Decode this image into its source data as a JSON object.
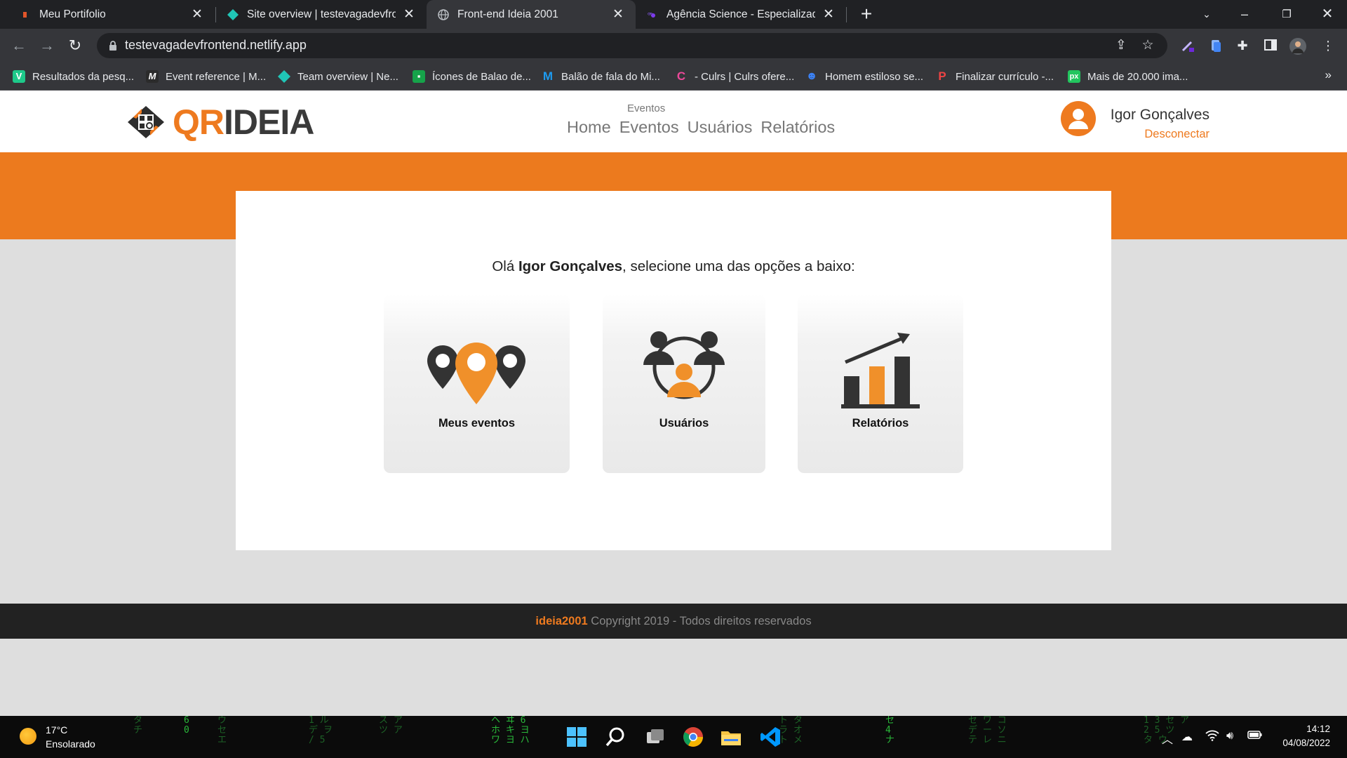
{
  "browser": {
    "tabs": [
      {
        "title": "Meu Portifolio",
        "active": false
      },
      {
        "title": "Site overview | testevagadevfront",
        "active": false
      },
      {
        "title": "Front-end Ideia 2001",
        "active": true
      },
      {
        "title": "Agência Science - Especializada e",
        "active": false
      }
    ],
    "new_tab_label": "+",
    "url": "testevagadevfrontend.netlify.app",
    "bookmarks": [
      {
        "label": "Resultados da pesq...",
        "icon": "v-logo-icon",
        "color": "#1ec98a"
      },
      {
        "label": "Event reference | M...",
        "icon": "mdn-icon",
        "color": "#2b2b2b"
      },
      {
        "label": "Team overview | Ne...",
        "icon": "netlify-icon",
        "color": "#20c6b7"
      },
      {
        "label": "Ícones de Balao de...",
        "icon": "flaticon-icon",
        "color": "#16a34a"
      },
      {
        "label": "Balão de fala do Mi...",
        "icon": "m-logo-icon",
        "color": "#1d9bf0"
      },
      {
        "label": "- Culrs | Culrs ofere...",
        "icon": "culrs-icon",
        "color": "#ec4899"
      },
      {
        "label": "Homem estiloso se...",
        "icon": "freepik-icon",
        "color": "#3b82f6"
      },
      {
        "label": "Finalizar currículo -...",
        "icon": "pdf-icon",
        "color": "#ef4444"
      },
      {
        "label": "Mais de 20.000 ima...",
        "icon": "pixabay-icon",
        "color": "#22c55e"
      }
    ],
    "bookmarks_more": "»"
  },
  "site": {
    "logo": {
      "part1": "QR",
      "part2": "IDEIA"
    },
    "nav_caption": "Eventos",
    "nav": [
      "Home",
      "Eventos",
      "Usuários",
      "Relatórios"
    ],
    "user_name": "Igor Gonçalves",
    "logout_label": "Desconectar",
    "greeting_prefix": "Olá ",
    "greeting_name": "Igor Gonçalves",
    "greeting_suffix": ", selecione uma das opções a baixo:",
    "cards": [
      {
        "label": "Meus eventos",
        "icon": "map-pins-icon"
      },
      {
        "label": "Usuários",
        "icon": "users-network-icon"
      },
      {
        "label": "Relatórios",
        "icon": "bar-chart-growth-icon"
      }
    ],
    "footer_brand": "ideia2001",
    "footer_text": " Copyright 2019 - Todos direitos reservados",
    "colors": {
      "accent": "#ee7a1f",
      "banner": "#ec7a1e",
      "footer_bg": "#222222",
      "page_bg": "#dedede"
    }
  },
  "taskbar": {
    "temperature": "17°C",
    "condition": "Ensolarado",
    "time": "14:12",
    "date": "04/08/2022"
  }
}
